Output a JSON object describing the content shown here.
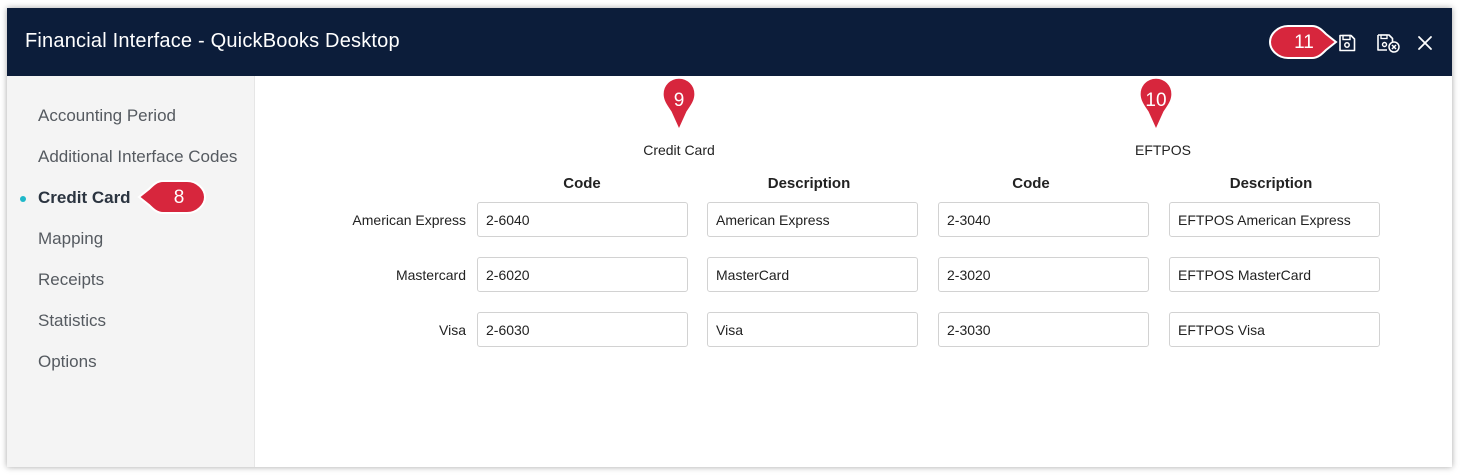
{
  "window": {
    "title": "Financial Interface - QuickBooks Desktop"
  },
  "toolbar": {
    "save_icon": "save-icon",
    "save_close_icon": "save-close-icon",
    "close_icon": "close-icon"
  },
  "sidebar": {
    "items": [
      {
        "label": "Accounting Period",
        "active": false
      },
      {
        "label": "Additional Interface Codes",
        "active": false
      },
      {
        "label": "Credit Card",
        "active": true
      },
      {
        "label": "Mapping",
        "active": false
      },
      {
        "label": "Receipts",
        "active": false
      },
      {
        "label": "Statistics",
        "active": false
      },
      {
        "label": "Options",
        "active": false
      }
    ]
  },
  "groups": [
    {
      "title": "Credit Card",
      "columns": [
        "Code",
        "Description"
      ]
    },
    {
      "title": "EFTPOS",
      "columns": [
        "Code",
        "Description"
      ]
    }
  ],
  "rows": [
    {
      "label": "American Express",
      "cc_code": "2-6040",
      "cc_description": "American Express",
      "eftpos_code": "2-3040",
      "eftpos_description": "EFTPOS American Express"
    },
    {
      "label": "Mastercard",
      "cc_code": "2-6020",
      "cc_description": "MasterCard",
      "eftpos_code": "2-3020",
      "eftpos_description": "EFTPOS MasterCard"
    },
    {
      "label": "Visa",
      "cc_code": "2-6030",
      "cc_description": "Visa",
      "eftpos_code": "2-3030",
      "eftpos_description": "EFTPOS Visa"
    }
  ],
  "callouts": {
    "c8": "8",
    "c9": "9",
    "c10": "10",
    "c11": "11"
  },
  "colors": {
    "titlebar": "#0c1d3a",
    "callout": "#d7263d",
    "active_dot": "#1fb8c9"
  }
}
